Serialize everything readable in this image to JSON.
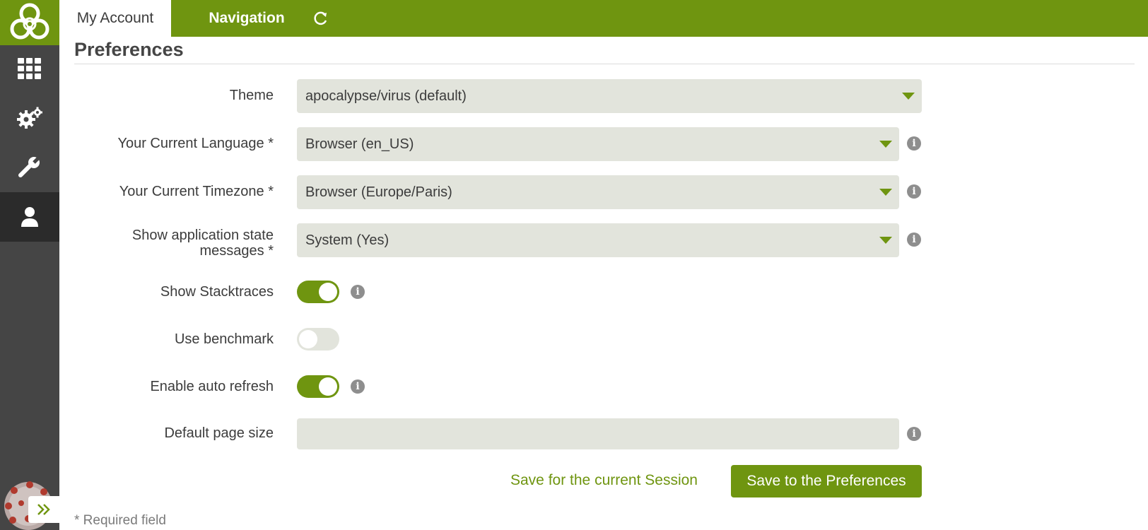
{
  "colors": {
    "accent": "#6f9510",
    "sidebar": "#454545",
    "field_bg": "#e2e4dc"
  },
  "sidebar": {
    "logo_icon": "biohazard-icon",
    "items": [
      {
        "icon": "grid-icon",
        "active": false
      },
      {
        "icon": "gears-icon",
        "active": false
      },
      {
        "icon": "wrench-icon",
        "active": false
      },
      {
        "icon": "user-icon",
        "active": true
      }
    ],
    "expand_icon": "double-chevron-right-icon"
  },
  "header": {
    "tabs": [
      {
        "label": "My Account",
        "active": true
      },
      {
        "label": "Navigation",
        "active": false
      }
    ],
    "refresh_icon": "refresh-icon"
  },
  "main": {
    "title": "Preferences",
    "fields": {
      "theme": {
        "label": "Theme",
        "value": "apocalypse/virus (default)"
      },
      "language": {
        "label": "Your Current Language *",
        "value": "Browser (en_US)"
      },
      "timezone": {
        "label": "Your Current Timezone *",
        "value": "Browser (Europe/Paris)"
      },
      "app_state": {
        "label_line1": "Show application state",
        "label_line2": "messages *",
        "value": "System (Yes)"
      },
      "stacktraces": {
        "label": "Show Stacktraces",
        "on": true
      },
      "benchmark": {
        "label": "Use benchmark",
        "on": false
      },
      "auto_refresh": {
        "label": "Enable auto refresh",
        "on": true
      },
      "page_size": {
        "label": "Default page size",
        "value": ""
      }
    },
    "info_glyph": "i",
    "actions": {
      "session_label": "Save for the current Session",
      "save_label": "Save to the Preferences"
    },
    "required_note": "* Required field"
  }
}
